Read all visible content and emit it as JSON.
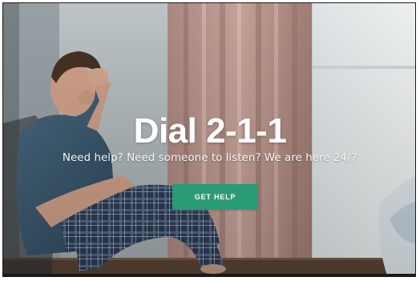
{
  "hero": {
    "title": "Dial 2-1-1",
    "subtitle": "Need help? Need someone to listen? We are here 24/7",
    "cta_label": "GET HELP"
  },
  "colors": {
    "cta_background": "#2b9b77",
    "title_text": "#ffffff"
  },
  "icons": []
}
